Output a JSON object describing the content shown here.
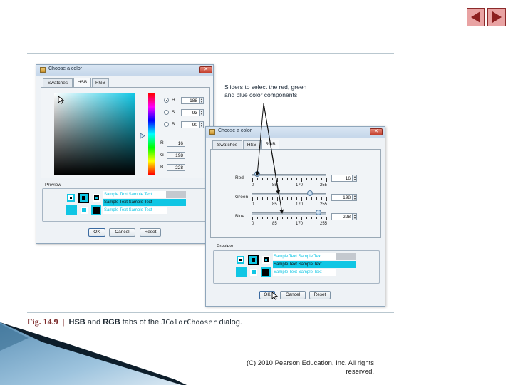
{
  "nav": {
    "prev_label": "◀",
    "next_label": "▶"
  },
  "dialog_hsb": {
    "title": "Choose a color",
    "tabs": [
      {
        "label": "Swatches"
      },
      {
        "label": "HSB"
      },
      {
        "label": "RGB"
      }
    ],
    "selected_tab": "HSB",
    "hsb_fields": [
      {
        "label": "H",
        "value": "188",
        "selected": true
      },
      {
        "label": "S",
        "value": "93",
        "selected": false
      },
      {
        "label": "B",
        "value": "90",
        "selected": false
      }
    ],
    "rgb_readout": [
      {
        "label": "R",
        "value": "16"
      },
      {
        "label": "G",
        "value": "198"
      },
      {
        "label": "B",
        "value": "228"
      }
    ],
    "preview_label": "Preview",
    "sample_text": "Sample Text  Sample Text",
    "buttons": {
      "ok": "OK",
      "cancel": "Cancel",
      "reset": "Reset"
    }
  },
  "dialog_rgb": {
    "title": "Choose a color",
    "tabs": [
      {
        "label": "Swatches"
      },
      {
        "label": "HSB"
      },
      {
        "label": "RGB"
      }
    ],
    "selected_tab": "RGB",
    "sliders": [
      {
        "label": "Red",
        "value": "16",
        "level": 16
      },
      {
        "label": "Green",
        "value": "198",
        "level": 198
      },
      {
        "label": "Blue",
        "value": "228",
        "level": 228
      }
    ],
    "tick_labels": [
      "0",
      "85",
      "170",
      "255"
    ],
    "slider_range": [
      0,
      255
    ],
    "preview_label": "Preview",
    "sample_text": "Sample Text  Sample Text",
    "buttons": {
      "ok": "OK",
      "cancel": "Cancel",
      "reset": "Reset"
    }
  },
  "callout": "Sliders to select the red, green and blue color components",
  "caption": {
    "fig": "Fig. 14.9",
    "sep": "|",
    "bold1": "HSB",
    "and1": " and ",
    "bold2": "RGB",
    "mid": " tabs of the ",
    "code": "JColorChooser",
    "end": " dialog."
  },
  "copyright": "(C) 2010 Pearson Education, Inc.  All rights reserved.",
  "colors": {
    "chosen": "#10c6e4",
    "chosen_dark": "#0aa3bd",
    "caption_accent": "#7b2a2a",
    "nav_fill": "#e9a3a3"
  }
}
